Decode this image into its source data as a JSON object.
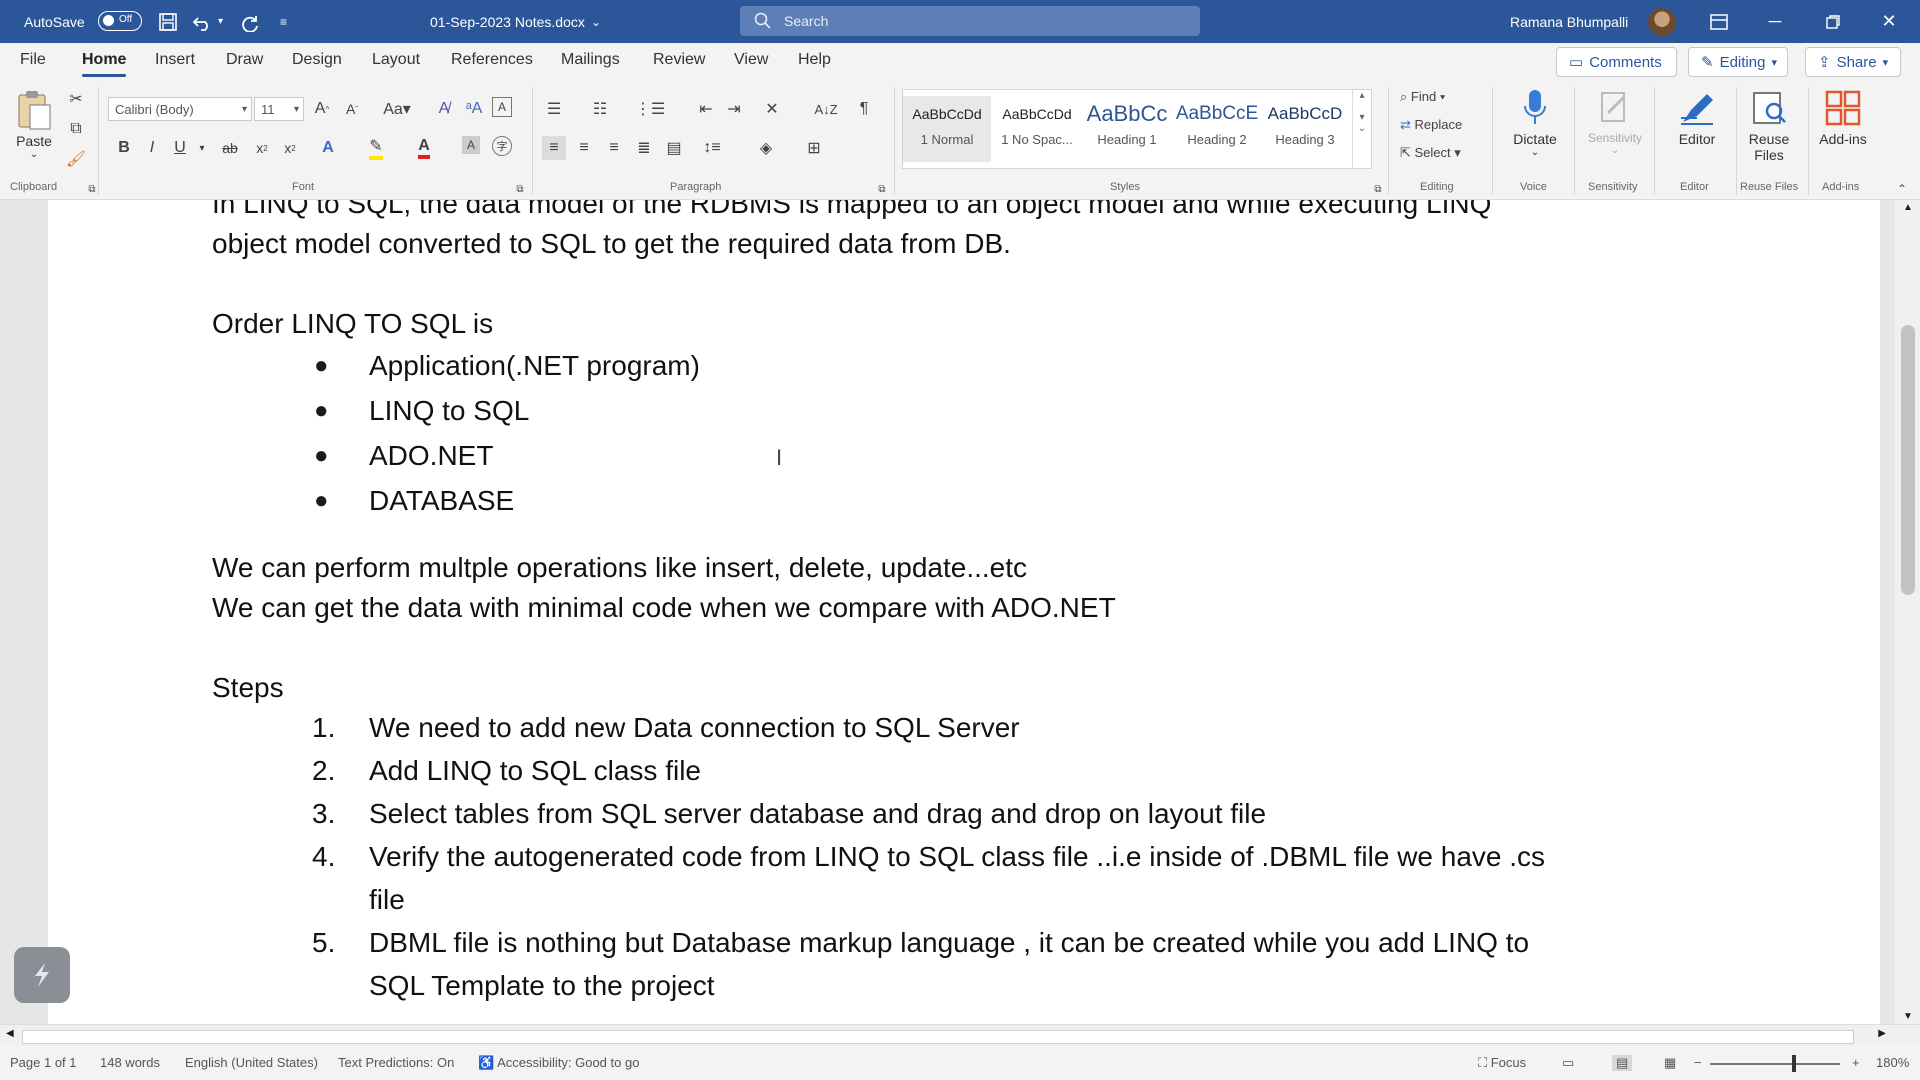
{
  "titlebar": {
    "autosave_label": "AutoSave",
    "autosave_state": "Off",
    "doc_title": "01-Sep-2023 Notes.docx",
    "search_placeholder": "Search",
    "user_name": "Ramana Bhumpalli"
  },
  "tabs": [
    "File",
    "Home",
    "Insert",
    "Draw",
    "Design",
    "Layout",
    "References",
    "Mailings",
    "Review",
    "View",
    "Help"
  ],
  "active_tab": "Home",
  "right_buttons": {
    "comments": "Comments",
    "editing": "Editing",
    "share": "Share"
  },
  "ribbon": {
    "clipboard": {
      "paste": "Paste",
      "label": "Clipboard"
    },
    "font": {
      "family": "Calibri (Body)",
      "size": "11",
      "label": "Font"
    },
    "paragraph": {
      "label": "Paragraph"
    },
    "styles": {
      "label": "Styles",
      "items": [
        {
          "sample": "AaBbCcDd",
          "name": "1 Normal"
        },
        {
          "sample": "AaBbCcDd",
          "name": "1 No Spac..."
        },
        {
          "sample": "AaBbCc",
          "name": "Heading 1"
        },
        {
          "sample": "AaBbCcE",
          "name": "Heading 2"
        },
        {
          "sample": "AaBbCcD",
          "name": "Heading 3"
        }
      ]
    },
    "editing": {
      "find": "Find",
      "replace": "Replace",
      "select": "Select",
      "label": "Editing"
    },
    "voice": {
      "dictate": "Dictate",
      "label": "Voice"
    },
    "sensitivity": {
      "button": "Sensitivity",
      "label": "Sensitivity"
    },
    "editor": {
      "button": "Editor",
      "label": "Editor"
    },
    "reuse": {
      "button_line1": "Reuse",
      "button_line2": "Files",
      "label": "Reuse Files"
    },
    "addins": {
      "button": "Add-ins",
      "label": "Add-ins"
    }
  },
  "document": {
    "intro_line1": "In LINQ to SQL, the data model of the RDBMS is mapped to an object model and while executing LINQ",
    "intro_line2": "object model converted to SQL to get the required data from DB.",
    "order_heading": "Order LINQ TO SQL is",
    "order_items": [
      "Application(.NET program)",
      "LINQ to SQL",
      "ADO.NET",
      "DATABASE"
    ],
    "ops_line1": "We can perform multple operations like insert, delete, update...etc",
    "ops_line2": " We can get the data with minimal code when we compare with ADO.NET",
    "steps_heading": "Steps",
    "steps": [
      {
        "num": "1.",
        "lines": [
          "We need to add new Data connection to SQL Server"
        ]
      },
      {
        "num": "2.",
        "lines": [
          "Add LINQ to SQL class file"
        ]
      },
      {
        "num": "3.",
        "lines": [
          "Select tables from SQL server database and drag and drop on layout file"
        ]
      },
      {
        "num": "4.",
        "lines": [
          "Verify the autogenerated code from LINQ to SQL class file ..i.e inside of .DBML file we have .cs",
          "file"
        ]
      },
      {
        "num": "5.",
        "lines": [
          "DBML file is nothing but Database markup language , it can be created while you add LINQ to",
          "SQL Template to the project"
        ]
      }
    ]
  },
  "statusbar": {
    "page": "Page 1 of 1",
    "words": "148 words",
    "language": "English (United States)",
    "predictions": "Text Predictions: On",
    "accessibility": "Accessibility: Good to go",
    "focus": "Focus",
    "zoom": "180%"
  },
  "colors": {
    "titlebar": "#2b579a",
    "accent": "#2b579a"
  }
}
